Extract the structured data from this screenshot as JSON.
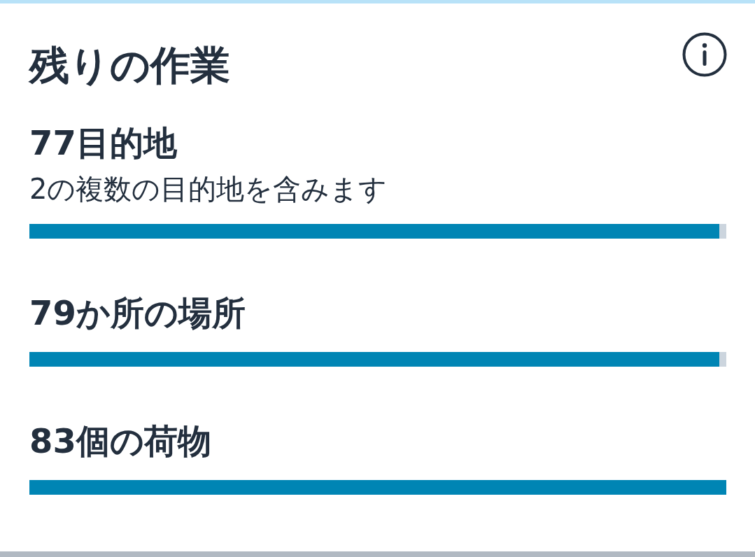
{
  "card": {
    "title": "残りの作業"
  },
  "metrics": [
    {
      "label": "77目的地",
      "note": "2の複数の目的地を含みます",
      "level": 0.99
    },
    {
      "label": "79か所の場所",
      "level": 0.99
    },
    {
      "label": "83個の荷物",
      "level": 1
    }
  ]
}
